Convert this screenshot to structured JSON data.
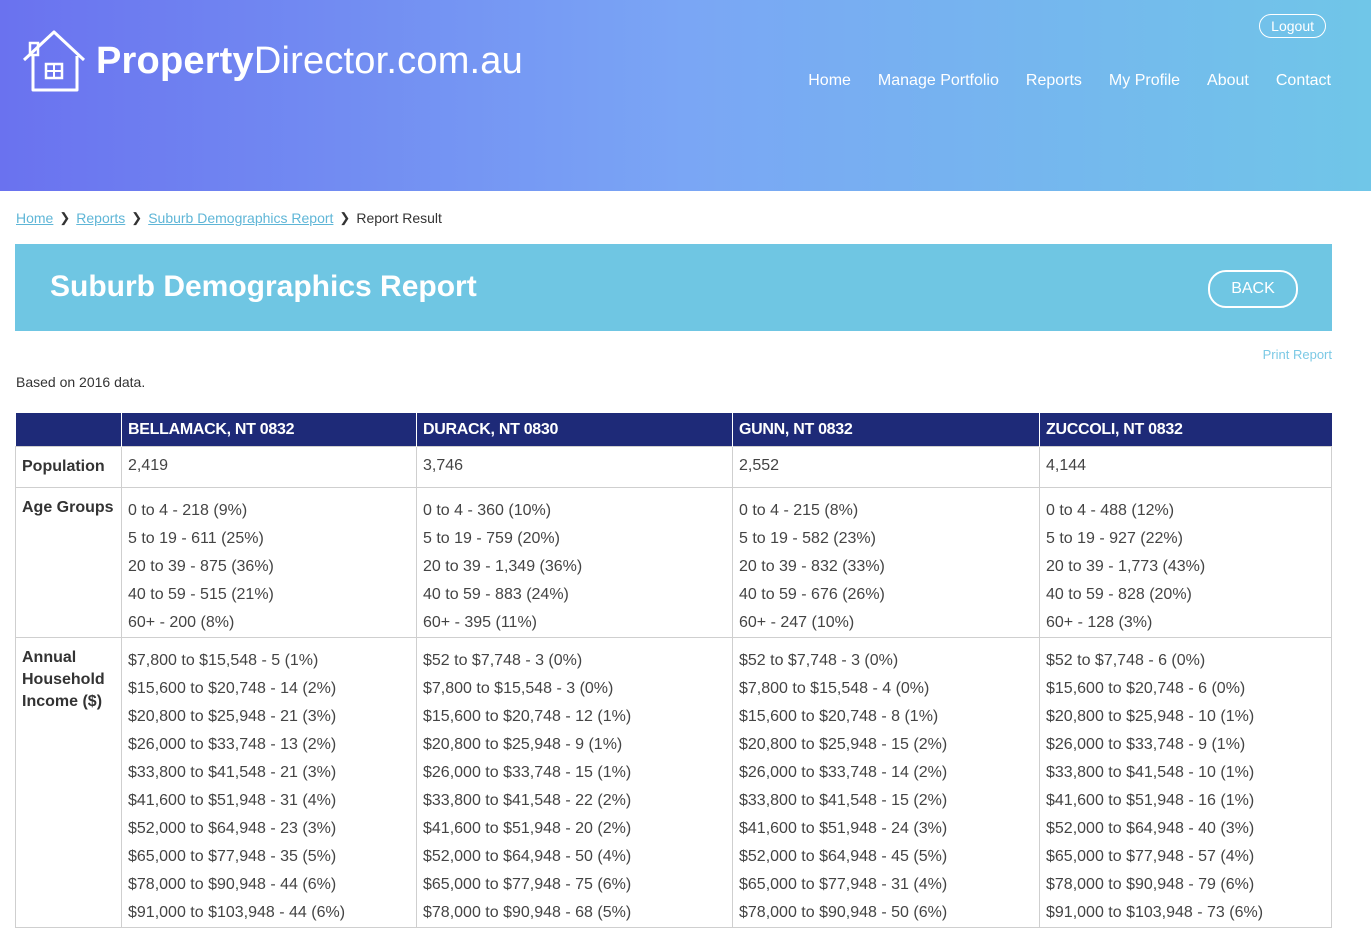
{
  "brand": {
    "bold": "Property",
    "rest": "Director.com.au"
  },
  "logout_label": "Logout",
  "nav": [
    "Home",
    "Manage Portfolio",
    "Reports",
    "My Profile",
    "About",
    "Contact"
  ],
  "breadcrumb": {
    "links": [
      "Home",
      "Reports",
      "Suburb Demographics Report"
    ],
    "current": "Report Result"
  },
  "page_title": "Suburb Demographics Report",
  "back_label": "BACK",
  "print_label": "Print Report",
  "based_on": "Based on 2016 data.",
  "table": {
    "columns": [
      "BELLAMACK, NT 0832",
      "DURACK, NT 0830",
      "GUNN, NT 0832",
      "ZUCCOLI, NT 0832"
    ],
    "rows": [
      {
        "label": "Population",
        "cells": [
          [
            "2,419"
          ],
          [
            "3,746"
          ],
          [
            "2,552"
          ],
          [
            "4,144"
          ]
        ]
      },
      {
        "label": "Age Groups",
        "cells": [
          [
            "0 to 4 - 218 (9%)",
            "5 to 19 - 611 (25%)",
            "20 to 39 - 875 (36%)",
            "40 to 59 - 515 (21%)",
            "60+ - 200 (8%)"
          ],
          [
            "0 to 4 - 360 (10%)",
            "5 to 19 - 759 (20%)",
            "20 to 39 - 1,349 (36%)",
            "40 to 59 - 883 (24%)",
            "60+ - 395 (11%)"
          ],
          [
            "0 to 4 - 215 (8%)",
            "5 to 19 - 582 (23%)",
            "20 to 39 - 832 (33%)",
            "40 to 59 - 676 (26%)",
            "60+ - 247 (10%)"
          ],
          [
            "0 to 4 - 488 (12%)",
            "5 to 19 - 927 (22%)",
            "20 to 39 - 1,773 (43%)",
            "40 to 59 - 828 (20%)",
            "60+ - 128 (3%)"
          ]
        ]
      },
      {
        "label": "Annual Household Income ($)",
        "cells": [
          [
            "$7,800 to $15,548 - 5 (1%)",
            "$15,600 to $20,748 - 14 (2%)",
            "$20,800 to $25,948 - 21 (3%)",
            "$26,000 to $33,748 - 13 (2%)",
            "$33,800 to $41,548 - 21 (3%)",
            "$41,600 to $51,948 - 31 (4%)",
            "$52,000 to $64,948 - 23 (3%)",
            "$65,000 to $77,948 - 35 (5%)",
            "$78,000 to $90,948 - 44 (6%)",
            "$91,000 to $103,948 - 44 (6%)"
          ],
          [
            "$52 to $7,748 - 3 (0%)",
            "$7,800 to $15,548 - 3 (0%)",
            "$15,600 to $20,748 - 12 (1%)",
            "$20,800 to $25,948 - 9 (1%)",
            "$26,000 to $33,748 - 15 (1%)",
            "$33,800 to $41,548 - 22 (2%)",
            "$41,600 to $51,948 - 20 (2%)",
            "$52,000 to $64,948 - 50 (4%)",
            "$65,000 to $77,948 - 75 (6%)",
            "$78,000 to $90,948 - 68 (5%)"
          ],
          [
            "$52 to $7,748 - 3 (0%)",
            "$7,800 to $15,548 - 4 (0%)",
            "$15,600 to $20,748 - 8 (1%)",
            "$20,800 to $25,948 - 15 (2%)",
            "$26,000 to $33,748 - 14 (2%)",
            "$33,800 to $41,548 - 15 (2%)",
            "$41,600 to $51,948 - 24 (3%)",
            "$52,000 to $64,948 - 45 (5%)",
            "$65,000 to $77,948 - 31 (4%)",
            "$78,000 to $90,948 - 50 (6%)"
          ],
          [
            "$52 to $7,748 - 6 (0%)",
            "$15,600 to $20,748 - 6 (0%)",
            "$20,800 to $25,948 - 10 (1%)",
            "$26,000 to $33,748 - 9 (1%)",
            "$33,800 to $41,548 - 10 (1%)",
            "$41,600 to $51,948 - 16 (1%)",
            "$52,000 to $64,948 - 40 (3%)",
            "$65,000 to $77,948 - 57 (4%)",
            "$78,000 to $90,948 - 79 (6%)",
            "$91,000 to $103,948 - 73 (6%)"
          ]
        ]
      }
    ]
  },
  "colors": {
    "header_start": "#6a72ef",
    "header_end": "#70c6e8",
    "banner": "#6fc6e3",
    "table_header": "#1e2a78",
    "link": "#5fb6d7"
  },
  "icons": {
    "logo": "house-icon",
    "breadcrumb_sep": "chevron-right-icon"
  }
}
